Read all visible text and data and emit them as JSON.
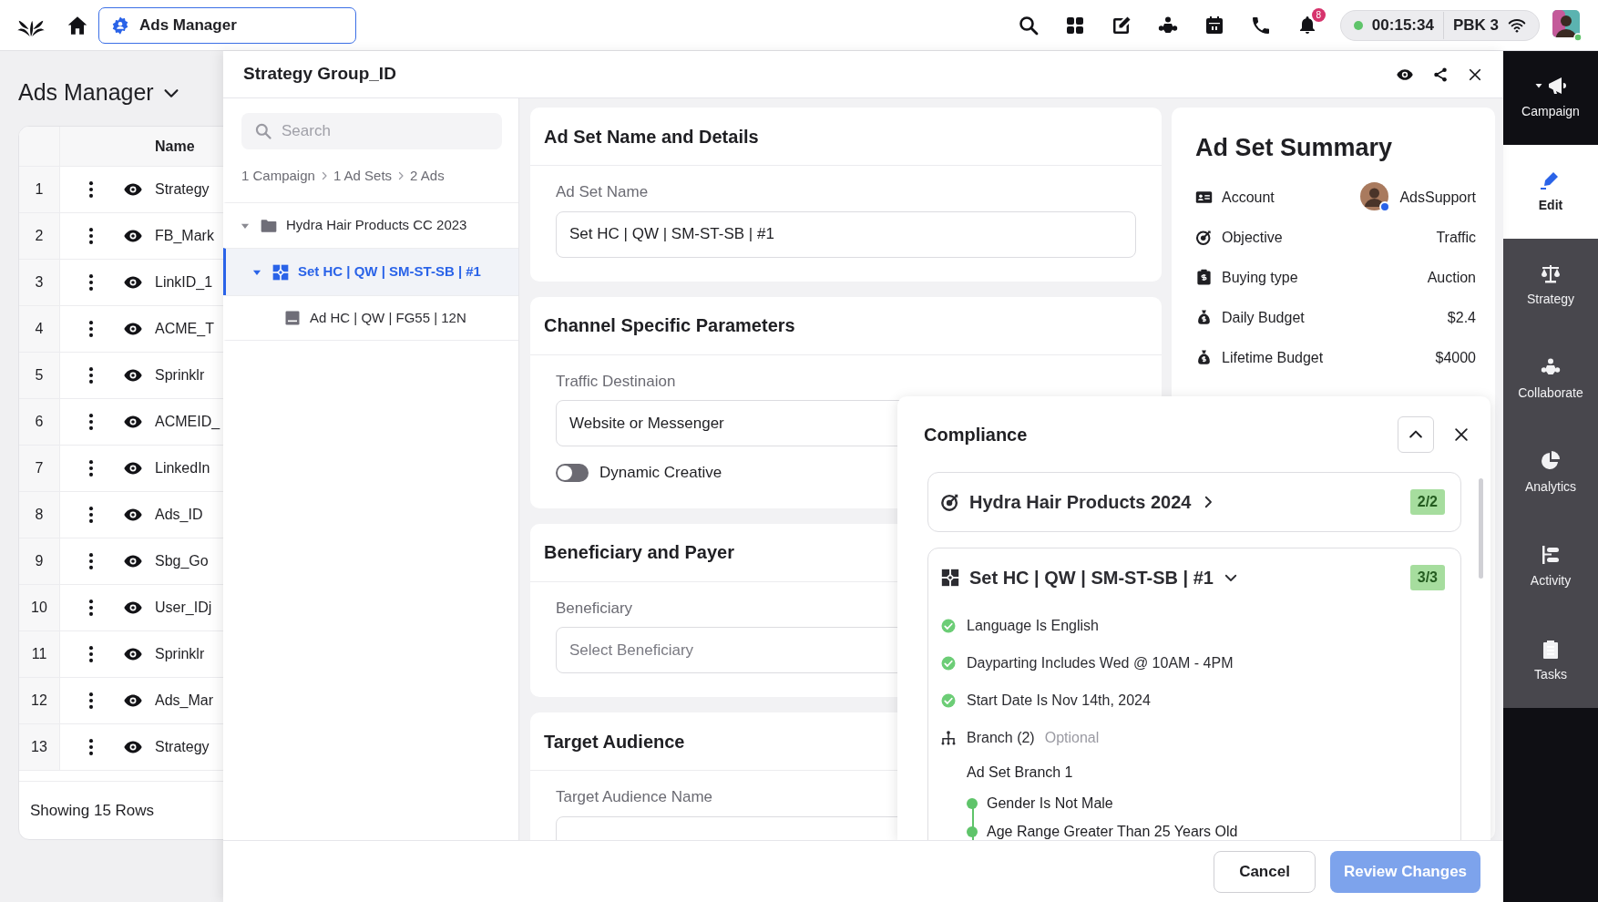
{
  "top_bar": {
    "app_switcher": {
      "label": "Ads Manager"
    },
    "notification_count": "8",
    "call_timer": "00:15:34",
    "workspace": "PBK 3"
  },
  "page": {
    "title": "Ads Manager",
    "table": {
      "columns": [
        "Name"
      ],
      "rows": [
        {
          "number": "1",
          "name": "Strategy"
        },
        {
          "number": "2",
          "name": "FB_Mark"
        },
        {
          "number": "3",
          "name": "LinkID_1"
        },
        {
          "number": "4",
          "name": "ACME_T"
        },
        {
          "number": "5",
          "name": "Sprinklr"
        },
        {
          "number": "6",
          "name": "ACMEID_"
        },
        {
          "number": "7",
          "name": "LinkedIn"
        },
        {
          "number": "8",
          "name": "Ads_ID"
        },
        {
          "number": "9",
          "name": "Sbg_Go"
        },
        {
          "number": "10",
          "name": "User_IDj"
        },
        {
          "number": "11",
          "name": "Sprinklr"
        },
        {
          "number": "12",
          "name": "Ads_Mar"
        },
        {
          "number": "13",
          "name": "Strategy"
        }
      ],
      "footer": "Showing 15 Rows"
    }
  },
  "drawer": {
    "title": "Strategy Group_ID",
    "search": {
      "placeholder": "Search"
    },
    "breadcrumb": [
      "1 Campaign",
      "1 Ad Sets",
      "2 Ads"
    ],
    "tree": [
      {
        "label": "Hydra Hair Products CC 2023",
        "kind": "campaign",
        "expanded": true,
        "selected": false,
        "children": [
          {
            "label": "Set HC | QW | SM-ST-SB | #1",
            "kind": "ad_set",
            "expanded": true,
            "selected": true,
            "children": [
              {
                "label": "Ad HC | QW | FG55 | 12N",
                "kind": "ad",
                "selected": false
              }
            ]
          }
        ]
      }
    ],
    "sections": [
      {
        "title": "Ad Set Name and Details",
        "fields": [
          {
            "kind": "input",
            "label": "Ad Set Name",
            "value": "Set HC | QW | SM-ST-SB | #1"
          }
        ]
      },
      {
        "title": "Channel Specific Parameters",
        "fields": [
          {
            "kind": "input",
            "label": "Traffic Destinaion",
            "value": "Website or Messenger"
          },
          {
            "kind": "toggle",
            "label": "Dynamic Creative",
            "on": false
          }
        ]
      },
      {
        "title": "Beneficiary and Payer",
        "fields": [
          {
            "kind": "input",
            "label": "Beneficiary",
            "placeholder": "Select Beneficiary"
          }
        ]
      },
      {
        "title": "Target Audience",
        "fields": [
          {
            "kind": "input",
            "label": "Target Audience Name"
          }
        ]
      }
    ],
    "summary": {
      "title": "Ad Set Summary",
      "rows": [
        {
          "kind": "account",
          "label": "Account",
          "value": "AdsSupport"
        },
        {
          "kind": "objective",
          "label": "Objective",
          "value": "Traffic"
        },
        {
          "kind": "buying",
          "label": "Buying type",
          "value": "Auction"
        },
        {
          "kind": "budget",
          "label": "Daily Budget",
          "value": "$2.4"
        },
        {
          "kind": "budget",
          "label": "Lifetime Budget",
          "value": "$4000"
        }
      ]
    },
    "compliance": {
      "title": "Compliance",
      "groups": [
        {
          "kind": "campaign",
          "title": "Hydra Hair Products 2024",
          "expanded": false,
          "count": "2/2"
        },
        {
          "kind": "ad_set",
          "title": "Set HC | QW | SM-ST-SB | #1",
          "expanded": true,
          "count": "3/3",
          "rules": [
            {
              "label": "Language Is English",
              "passed": true
            },
            {
              "label": "Dayparting Includes Wed @ 10AM - 4PM",
              "passed": true
            },
            {
              "label": "Start Date Is Nov 14th, 2024",
              "passed": true
            }
          ],
          "branch": {
            "label": "Branch (2)",
            "note": "Optional",
            "branches": [
              {
                "title": "Ad Set Branch 1",
                "conditions": [
                  "Gender Is Not Male",
                  "Age Range Greater Than 25 Years Old"
                ]
              }
            ]
          }
        }
      ]
    },
    "buttons": [
      {
        "label": "Cancel",
        "kind": "secondary",
        "disabled": false
      },
      {
        "label": "Review Changes",
        "kind": "primary",
        "disabled": true
      }
    ]
  },
  "rail": [
    {
      "label": "Campaign",
      "kind": "campaign",
      "selected": false
    },
    {
      "label": "Edit",
      "kind": "edit",
      "selected": true
    },
    {
      "label": "Strategy",
      "kind": "strategy",
      "selected": false
    },
    {
      "label": "Collaborate",
      "kind": "collaborate",
      "selected": false
    },
    {
      "label": "Analytics",
      "kind": "analytics",
      "selected": false
    },
    {
      "label": "Activity",
      "kind": "activity",
      "selected": false
    },
    {
      "label": "Tasks",
      "kind": "tasks",
      "selected": false
    }
  ]
}
